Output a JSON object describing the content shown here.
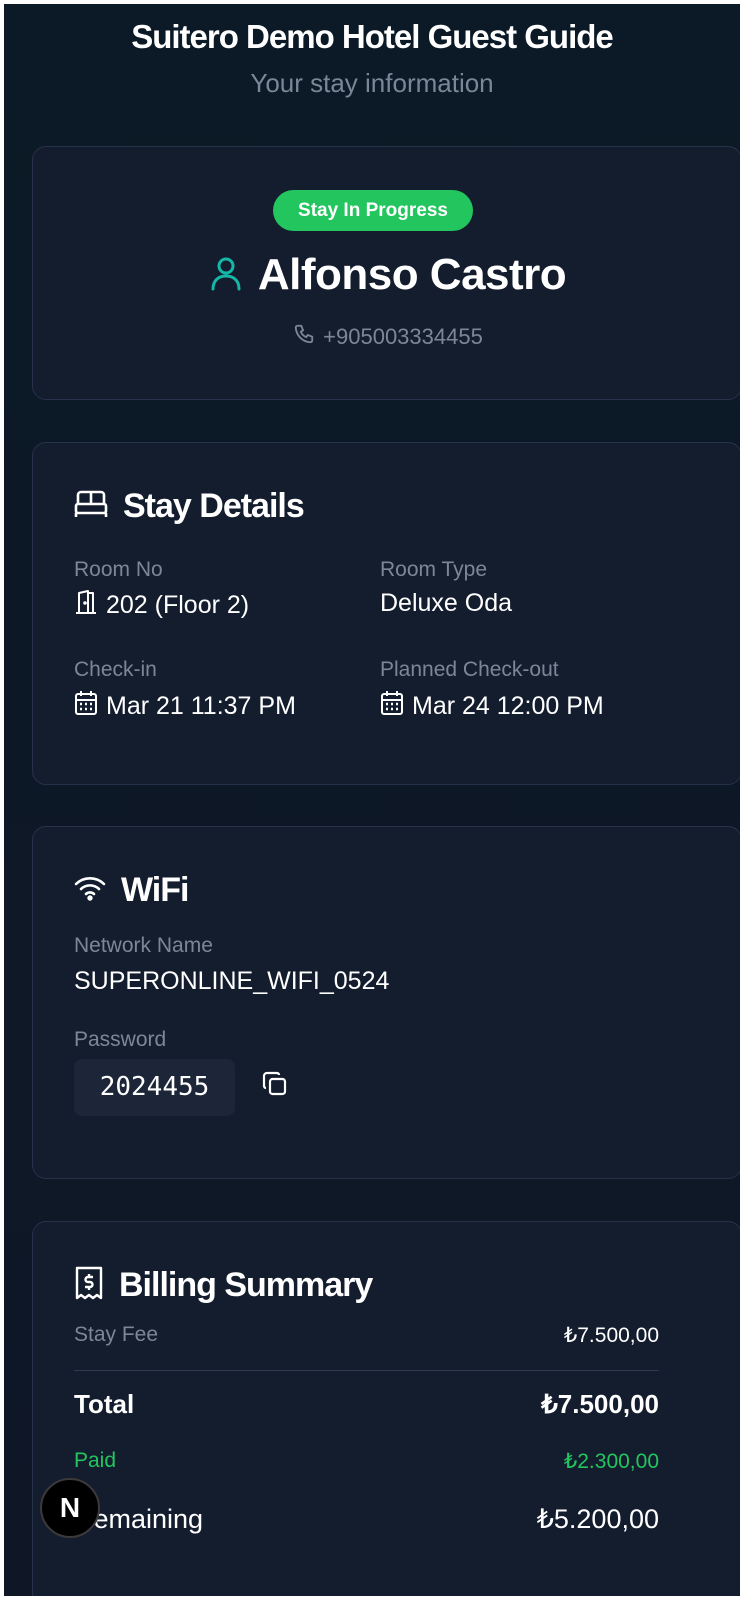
{
  "header": {
    "title": "Suitero Demo Hotel Guest Guide",
    "subtitle": "Your stay information"
  },
  "guest": {
    "status_badge": "Stay In Progress",
    "name": "Alfonso Castro",
    "phone": "+905003334455"
  },
  "stay_details": {
    "title": "Stay Details",
    "room_no_label": "Room No",
    "room_no_value": "202 (Floor 2)",
    "room_type_label": "Room Type",
    "room_type_value": "Deluxe Oda",
    "checkin_label": "Check-in",
    "checkin_value": "Mar 21 11:37 PM",
    "checkout_label": "Planned Check-out",
    "checkout_value": "Mar 24 12:00 PM"
  },
  "wifi": {
    "title": "WiFi",
    "network_label": "Network Name",
    "network_value": "SUPERONLINE_WIFI_0524",
    "password_label": "Password",
    "password_value": "2024455"
  },
  "billing": {
    "title": "Billing Summary",
    "stay_fee_label": "Stay Fee",
    "stay_fee_value": "₺7.500,00",
    "total_label": "Total",
    "total_value": "₺7.500,00",
    "paid_label": "Paid",
    "paid_value": "₺2.300,00",
    "remaining_label": "Remaining",
    "remaining_value": "₺5.200,00"
  },
  "fab": {
    "label": "N"
  },
  "icons": {
    "guest": "user-icon",
    "phone": "phone-icon",
    "stay": "bed-icon",
    "room": "door-icon",
    "calendar": "calendar-icon",
    "wifi": "wifi-icon",
    "copy": "copy-icon",
    "billing": "receipt-icon"
  },
  "colors": {
    "accent_green": "#22c55e",
    "teal_icon": "#14b8a6",
    "muted_text": "#7b8797",
    "card_bg": "#141d2e"
  }
}
